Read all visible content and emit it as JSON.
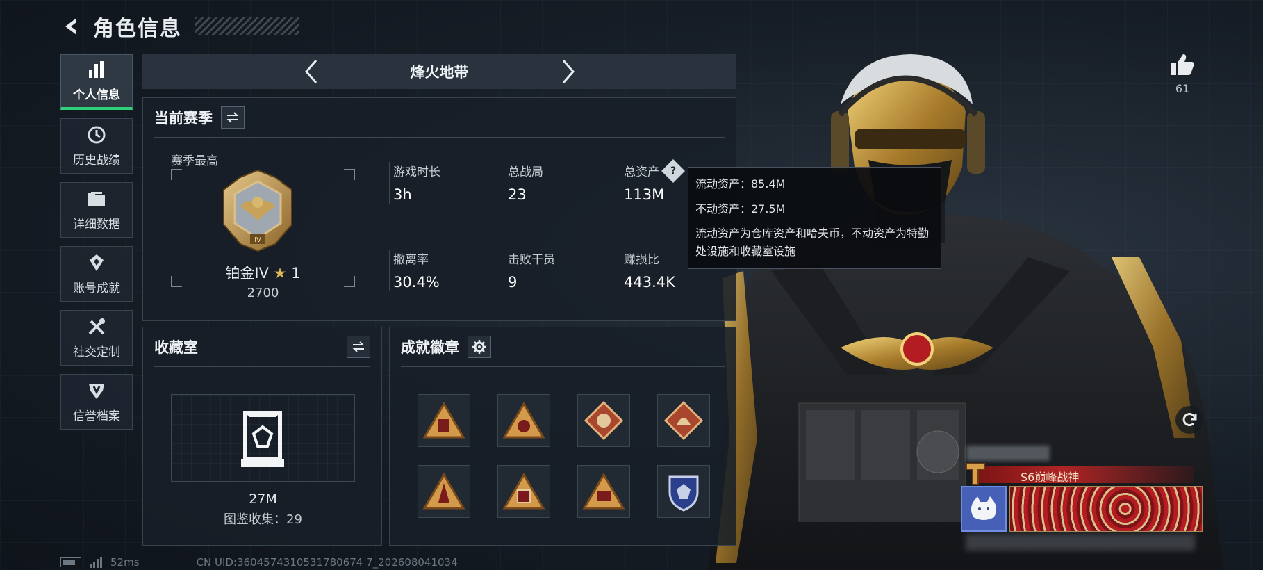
{
  "header": {
    "title": "角色信息"
  },
  "sidebar": {
    "items": [
      {
        "label": "个人信息",
        "icon": "bar-chart-icon",
        "active": true
      },
      {
        "label": "历史战绩",
        "icon": "history-clock-icon",
        "active": false
      },
      {
        "label": "详细数据",
        "icon": "folder-icon",
        "active": false
      },
      {
        "label": "账号成就",
        "icon": "achievement-icon",
        "active": false
      },
      {
        "label": "社交定制",
        "icon": "tools-icon",
        "active": false
      },
      {
        "label": "信誉档案",
        "icon": "shield-icon",
        "active": false
      }
    ]
  },
  "map_selector": {
    "current": "烽火地带"
  },
  "season": {
    "title": "当前赛季",
    "subtitle": "赛季最高",
    "rank_name": "铂金IV",
    "rank_star": "★",
    "rank_stars_count": "1",
    "rank_score": "2700",
    "stats": [
      {
        "label": "游戏时长",
        "value": "3h"
      },
      {
        "label": "总战局",
        "value": "23"
      },
      {
        "label": "总资产",
        "value": "113M"
      },
      {
        "label": "撤离率",
        "value": "30.4%"
      },
      {
        "label": "击败干员",
        "value": "9"
      },
      {
        "label": "赚损比",
        "value": "443.4K"
      }
    ]
  },
  "tooltip": {
    "liquid": "流动资产：85.4M",
    "fixed": "不动资产：27.5M",
    "description": "流动资产为仓库资产和哈夫币，不动资产为特勤处设施和收藏室设施"
  },
  "vault": {
    "title": "收藏室",
    "value": "27M",
    "collection": "图鉴收集：29"
  },
  "badges": {
    "title": "成就徽章",
    "count": 8
  },
  "likes": {
    "count": "61"
  },
  "player_card": {
    "title": "S6巅峰战神"
  },
  "status_bar": {
    "ping": "52ms",
    "uid": "CN UID:3604574310531780674 7_202608041034"
  },
  "colors": {
    "accent_green": "#2fd07a",
    "gold": "#d8b85a",
    "title_red": "#b02424"
  }
}
